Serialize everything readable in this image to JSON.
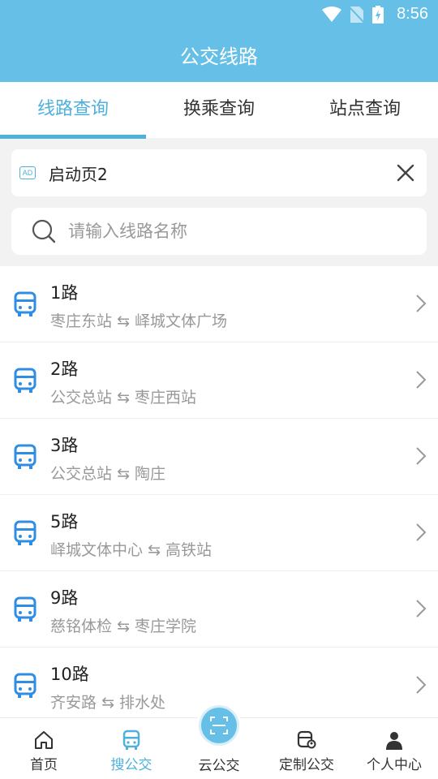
{
  "status": {
    "time": "8:56"
  },
  "header": {
    "title": "公交线路"
  },
  "tabs": [
    {
      "label": "线路查询",
      "active": true
    },
    {
      "label": "换乘查询",
      "active": false
    },
    {
      "label": "站点查询",
      "active": false
    }
  ],
  "ad": {
    "badge": "AD",
    "text": "启动页2"
  },
  "search": {
    "placeholder": "请输入线路名称",
    "value": ""
  },
  "routes": [
    {
      "name": "1路",
      "from": "枣庄东站",
      "to": "峄城文体广场"
    },
    {
      "name": "2路",
      "from": "公交总站",
      "to": "枣庄西站"
    },
    {
      "name": "3路",
      "from": "公交总站",
      "to": "陶庄"
    },
    {
      "name": "5路",
      "from": "峄城文体中心",
      "to": "高铁站"
    },
    {
      "name": "9路",
      "from": "慈铭体检",
      "to": "枣庄学院"
    },
    {
      "name": "10路",
      "from": "齐安路",
      "to": "排水处"
    }
  ],
  "route_separator": "⇆",
  "bottom_nav": [
    {
      "label": "首页",
      "icon": "home-icon"
    },
    {
      "label": "搜公交",
      "icon": "bus-icon",
      "active": true
    },
    {
      "label": "云公交",
      "icon": "scan-icon"
    },
    {
      "label": "定制公交",
      "icon": "custom-bus-icon"
    },
    {
      "label": "个人中心",
      "icon": "person-icon"
    }
  ],
  "colors": {
    "primary": "#66bfe6",
    "accent": "#4fb0dd",
    "bus_icon": "#2f8de4"
  }
}
